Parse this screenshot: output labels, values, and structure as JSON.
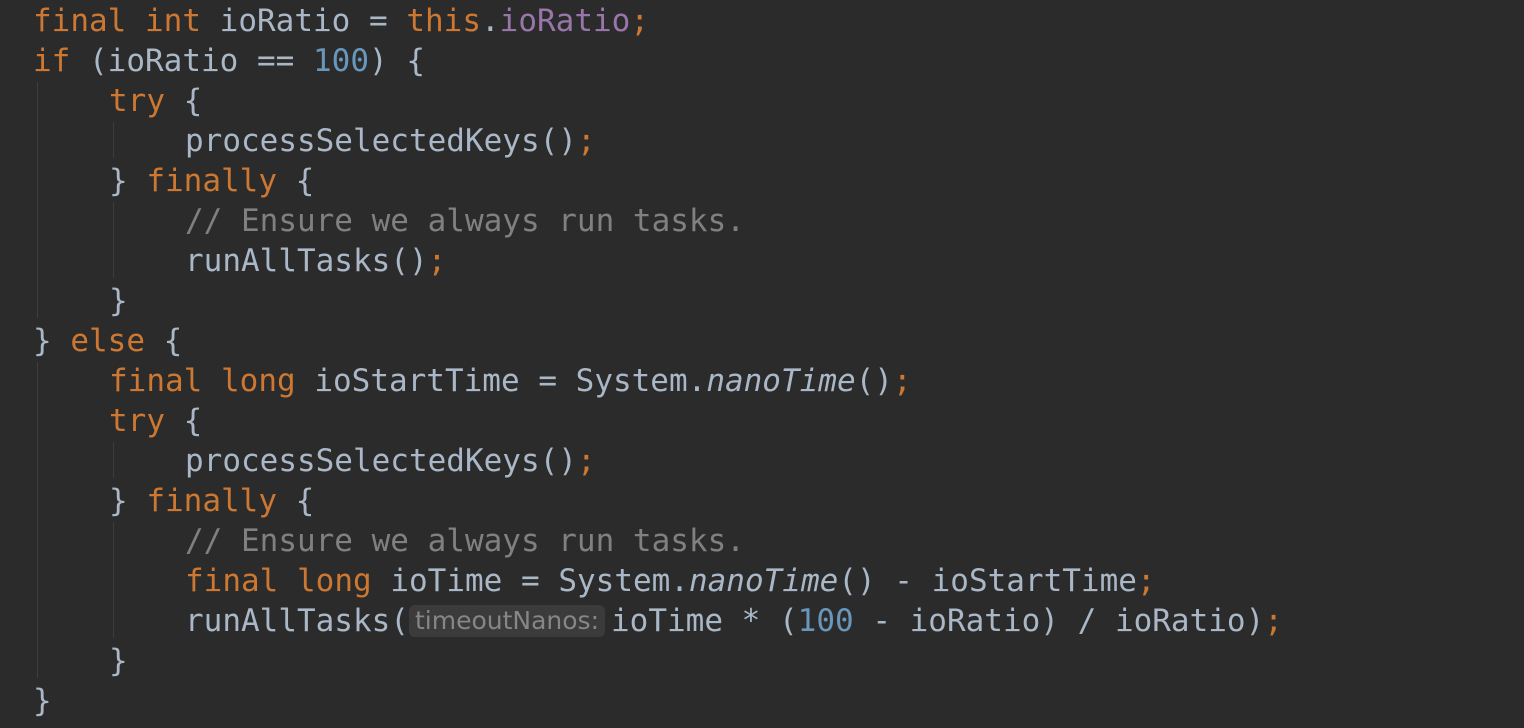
{
  "code": {
    "l1": {
      "kw1": "final",
      "kw2": "int",
      "var": "ioRatio",
      "eq": "=",
      "kw3": "this",
      "dot": ".",
      "field": "ioRatio",
      "semi": ";"
    },
    "l2": {
      "kw": "if",
      "open": "(",
      "var": "ioRatio",
      "op": "==",
      "num": "100",
      "close": ")",
      "brace": "{"
    },
    "l3": {
      "kw": "try",
      "brace": "{"
    },
    "l4": {
      "call": "processSelectedKeys()",
      "semi": ";"
    },
    "l5": {
      "brace": "}",
      "kw": "finally",
      "brace2": "{"
    },
    "l6": {
      "comment": "// Ensure we always run tasks."
    },
    "l7": {
      "call": "runAllTasks()",
      "semi": ";"
    },
    "l8": {
      "brace": "}"
    },
    "l9": {
      "brace": "}",
      "kw": "else",
      "brace2": "{"
    },
    "l10": {
      "kw1": "final",
      "kw2": "long",
      "var": "ioStartTime",
      "eq": "=",
      "cls": "System.",
      "method": "nanoTime",
      "paren": "()",
      "semi": ";"
    },
    "l11": {
      "kw": "try",
      "brace": "{"
    },
    "l12": {
      "call": "processSelectedKeys()",
      "semi": ";"
    },
    "l13": {
      "brace": "}",
      "kw": "finally",
      "brace2": "{"
    },
    "l14": {
      "comment": "// Ensure we always run tasks."
    },
    "l15": {
      "kw1": "final",
      "kw2": "long",
      "var": "ioTime",
      "eq": "=",
      "cls": "System.",
      "method": "nanoTime",
      "rest": "() - ioStartTime",
      "semi": ";"
    },
    "l16": {
      "call": "runAllTasks(",
      "hint": "timeoutNanos:",
      "expr1": "ioTime * (",
      "num": "100",
      "expr2": " - ioRatio) / ioRatio)",
      "semi": ";"
    },
    "l17": {
      "brace": "}"
    },
    "l18": {
      "brace": "}"
    }
  },
  "colors": {
    "background": "#2b2b2b",
    "keyword": "#cc7832",
    "identifier": "#a9b7c6",
    "field": "#9876aa",
    "number": "#6897bb",
    "comment": "#808080",
    "hint_background": "#3b3b3b",
    "hint_text": "#868686"
  }
}
